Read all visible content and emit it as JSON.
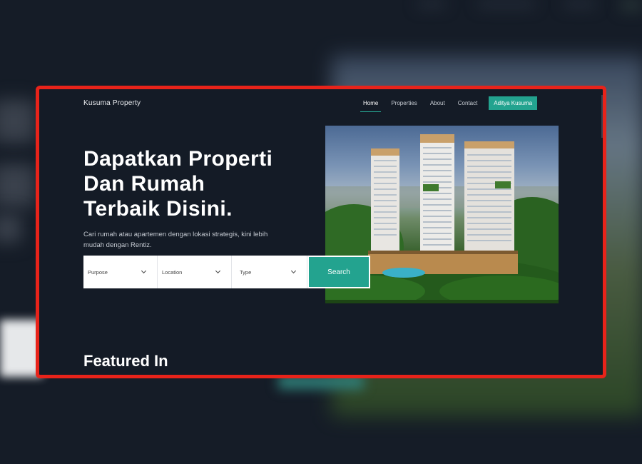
{
  "brand": "Kusuma Property",
  "nav": {
    "items": [
      {
        "label": "Home",
        "active": true
      },
      {
        "label": "Properties",
        "active": false
      },
      {
        "label": "About",
        "active": false
      },
      {
        "label": "Contact",
        "active": false
      }
    ],
    "user_button": "Aditya Kusuma"
  },
  "hero": {
    "title_line1": "Dapatkan Properti",
    "title_line2": "Dan Rumah",
    "title_line3": "Terbaik Disini.",
    "subtitle_line1": "Cari rumah atau apartemen dengan lokasi strategis, kini lebih",
    "subtitle_line2": "mudah dengan Rentiz."
  },
  "search": {
    "purpose": "Purpose",
    "location": "Location",
    "type": "Type",
    "button": "Search"
  },
  "featured": {
    "heading": "Featured In"
  },
  "colors": {
    "background": "#141b26",
    "accent": "#23a38f",
    "frame": "#e8231a"
  }
}
